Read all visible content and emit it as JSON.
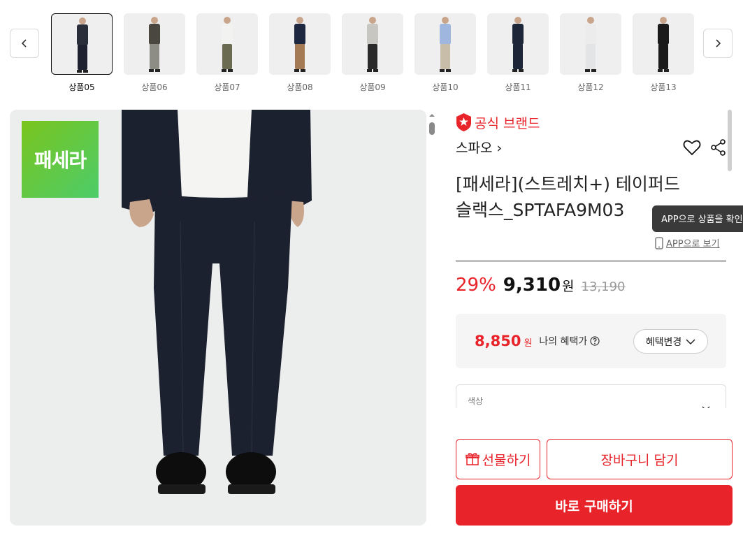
{
  "thumbnails": [
    {
      "label": "상품05",
      "pants": "#1e2230",
      "top": "#2a2e3a",
      "active": true
    },
    {
      "label": "상품06",
      "pants": "#8d8d86",
      "top": "#4a4640",
      "active": false
    },
    {
      "label": "상품07",
      "pants": "#6b6b52",
      "top": "#f2f2f0",
      "active": false
    },
    {
      "label": "상품08",
      "pants": "#a47a55",
      "top": "#1d2740",
      "active": false
    },
    {
      "label": "상품09",
      "pants": "#2a2a2a",
      "top": "#c8c6c0",
      "active": false
    },
    {
      "label": "상품10",
      "pants": "#c8bda8",
      "top": "#9fb6de",
      "active": false
    },
    {
      "label": "상품11",
      "pants": "#1d2638",
      "top": "#1d2638",
      "active": false
    },
    {
      "label": "상품12",
      "pants": "#e2e4e6",
      "top": "#ececec",
      "active": false
    },
    {
      "label": "상품13",
      "pants": "#1a1a1a",
      "top": "#1a1a1a",
      "active": false
    }
  ],
  "main_image": {
    "logo_text": "패세라",
    "suit_color": "#1c2130",
    "shirt_color": "#f4f4f2"
  },
  "product": {
    "official_label": "공식 브랜드",
    "brand": "스파오 ›",
    "title_line1": "[패세라](스트레치+) 테이퍼드",
    "title_line2": "슬랙스_SPTAFA9M03",
    "app_tooltip": "APP으로 상품을 확인",
    "app_view": "APP으로 보기"
  },
  "pricing": {
    "discount": "29%",
    "price": "9,310",
    "price_unit": "원",
    "original": "13,190"
  },
  "benefit": {
    "price": "8,850",
    "unit": "원",
    "label": "나의 혜택가",
    "button": "혜택변경"
  },
  "options": {
    "color_label": "색상"
  },
  "buttons": {
    "gift": "선물하기",
    "cart": "장바구니 담기",
    "buy": "바로 구매하기"
  },
  "colors": {
    "accent": "#e8232a",
    "logo_gradient_start": "#7ac51d",
    "logo_gradient_end": "#4ccc6a"
  }
}
